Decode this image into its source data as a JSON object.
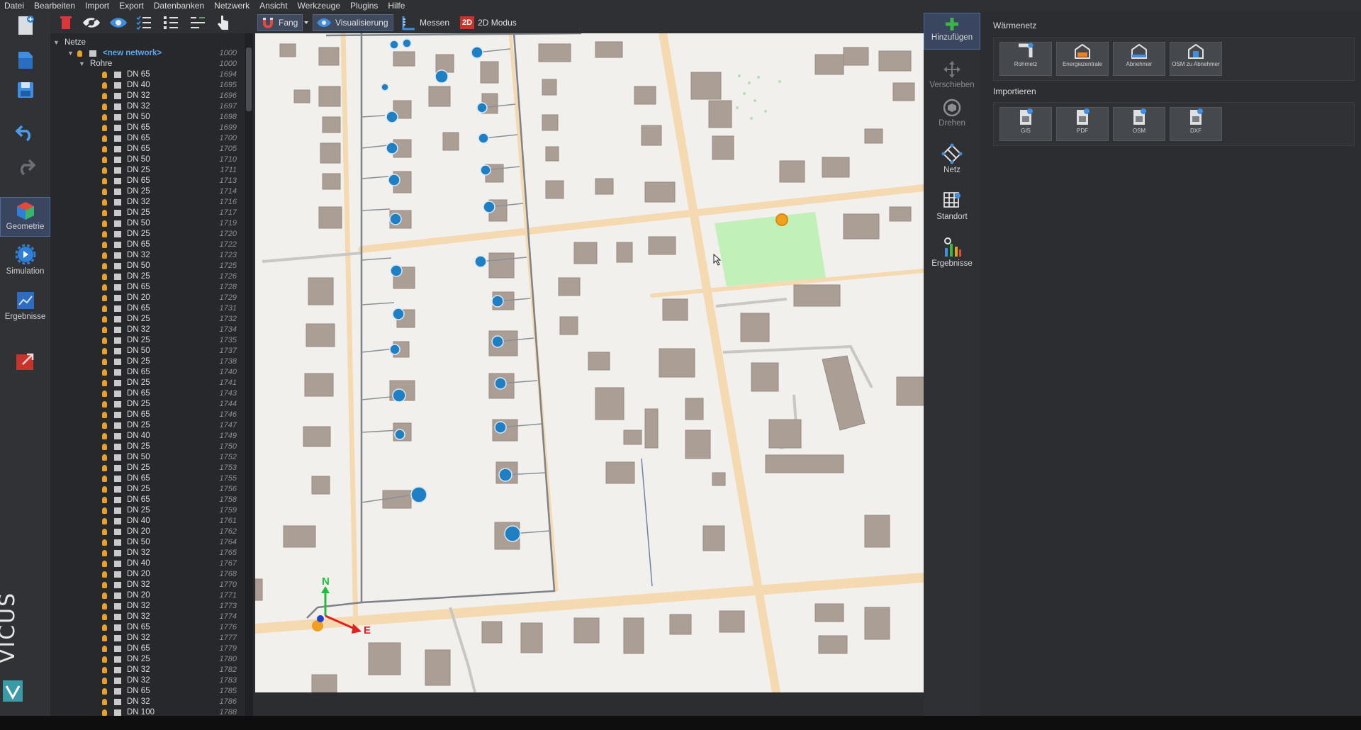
{
  "menu": [
    "Datei",
    "Bearbeiten",
    "Import",
    "Export",
    "Datenbanken",
    "Netzwerk",
    "Ansicht",
    "Werkzeuge",
    "Plugins",
    "Hilfe"
  ],
  "leftbar": {
    "geometry_label": "Geometrie",
    "simulation_label": "Simulation",
    "results_label": "Ergebnisse",
    "brand": "VICUS"
  },
  "toolbar": {
    "snap_label": "Fang",
    "visualization_label": "Visualisierung",
    "measure_label": "Messen",
    "mode2d_badge": "2D",
    "mode2d_label": "2D Modus"
  },
  "tree": {
    "root_label": "Netze",
    "network_label": "<new network>",
    "network_id": "1000",
    "pipes_label": "Rohre",
    "pipes_id": "1000",
    "pipes": [
      {
        "name": "DN 65",
        "id": "1694"
      },
      {
        "name": "DN 40",
        "id": "1695"
      },
      {
        "name": "DN 32",
        "id": "1696"
      },
      {
        "name": "DN 32",
        "id": "1697"
      },
      {
        "name": "DN 50",
        "id": "1698"
      },
      {
        "name": "DN 65",
        "id": "1699"
      },
      {
        "name": "DN 65",
        "id": "1700"
      },
      {
        "name": "DN 65",
        "id": "1705"
      },
      {
        "name": "DN 50",
        "id": "1710"
      },
      {
        "name": "DN 25",
        "id": "1711"
      },
      {
        "name": "DN 65",
        "id": "1713"
      },
      {
        "name": "DN 25",
        "id": "1714"
      },
      {
        "name": "DN 32",
        "id": "1716"
      },
      {
        "name": "DN 25",
        "id": "1717"
      },
      {
        "name": "DN 50",
        "id": "1719"
      },
      {
        "name": "DN 25",
        "id": "1720"
      },
      {
        "name": "DN 65",
        "id": "1722"
      },
      {
        "name": "DN 32",
        "id": "1723"
      },
      {
        "name": "DN 50",
        "id": "1725"
      },
      {
        "name": "DN 25",
        "id": "1726"
      },
      {
        "name": "DN 65",
        "id": "1728"
      },
      {
        "name": "DN 20",
        "id": "1729"
      },
      {
        "name": "DN 65",
        "id": "1731"
      },
      {
        "name": "DN 25",
        "id": "1732"
      },
      {
        "name": "DN 32",
        "id": "1734"
      },
      {
        "name": "DN 25",
        "id": "1735"
      },
      {
        "name": "DN 50",
        "id": "1737"
      },
      {
        "name": "DN 25",
        "id": "1738"
      },
      {
        "name": "DN 65",
        "id": "1740"
      },
      {
        "name": "DN 25",
        "id": "1741"
      },
      {
        "name": "DN 65",
        "id": "1743"
      },
      {
        "name": "DN 25",
        "id": "1744"
      },
      {
        "name": "DN 65",
        "id": "1746"
      },
      {
        "name": "DN 25",
        "id": "1747"
      },
      {
        "name": "DN 40",
        "id": "1749"
      },
      {
        "name": "DN 25",
        "id": "1750"
      },
      {
        "name": "DN 50",
        "id": "1752"
      },
      {
        "name": "DN 25",
        "id": "1753"
      },
      {
        "name": "DN 65",
        "id": "1755"
      },
      {
        "name": "DN 25",
        "id": "1756"
      },
      {
        "name": "DN 65",
        "id": "1758"
      },
      {
        "name": "DN 25",
        "id": "1759"
      },
      {
        "name": "DN 40",
        "id": "1761"
      },
      {
        "name": "DN 20",
        "id": "1762"
      },
      {
        "name": "DN 50",
        "id": "1764"
      },
      {
        "name": "DN 32",
        "id": "1765"
      },
      {
        "name": "DN 40",
        "id": "1767"
      },
      {
        "name": "DN 20",
        "id": "1768"
      },
      {
        "name": "DN 32",
        "id": "1770"
      },
      {
        "name": "DN 20",
        "id": "1771"
      },
      {
        "name": "DN 32",
        "id": "1773"
      },
      {
        "name": "DN 32",
        "id": "1774"
      },
      {
        "name": "DN 65",
        "id": "1776"
      },
      {
        "name": "DN 32",
        "id": "1777"
      },
      {
        "name": "DN 65",
        "id": "1779"
      },
      {
        "name": "DN 25",
        "id": "1780"
      },
      {
        "name": "DN 32",
        "id": "1782"
      },
      {
        "name": "DN 32",
        "id": "1783"
      },
      {
        "name": "DN 65",
        "id": "1785"
      },
      {
        "name": "DN 32",
        "id": "1786"
      },
      {
        "name": "DN 100",
        "id": "1788"
      }
    ]
  },
  "viewport": {
    "axis_north": "N",
    "axis_east": "E",
    "colors": {
      "ground": "#f1f0ec",
      "road": "#f5d9b0",
      "building": "#ab9e95",
      "pipe": "#7c8288",
      "node": "#1f7fc4",
      "source": "#f0a020",
      "highlight": "#b8f0b0"
    }
  },
  "right_tools": {
    "add_label": "Hinzufügen",
    "move_label": "Verschieben",
    "rotate_label": "Drehen",
    "network_label": "Netz",
    "site_label": "Standort",
    "results_label": "Ergebnisse"
  },
  "right_panel": {
    "heat_network_title": "Wärmenetz",
    "heat_buttons": [
      "Rohrnetz",
      "Energiezentrale",
      "Abnehmer",
      "OSM zu Abnehmer"
    ],
    "import_title": "Importieren",
    "import_buttons": [
      "GIS",
      "PDF",
      "OSM",
      "DXF"
    ]
  }
}
